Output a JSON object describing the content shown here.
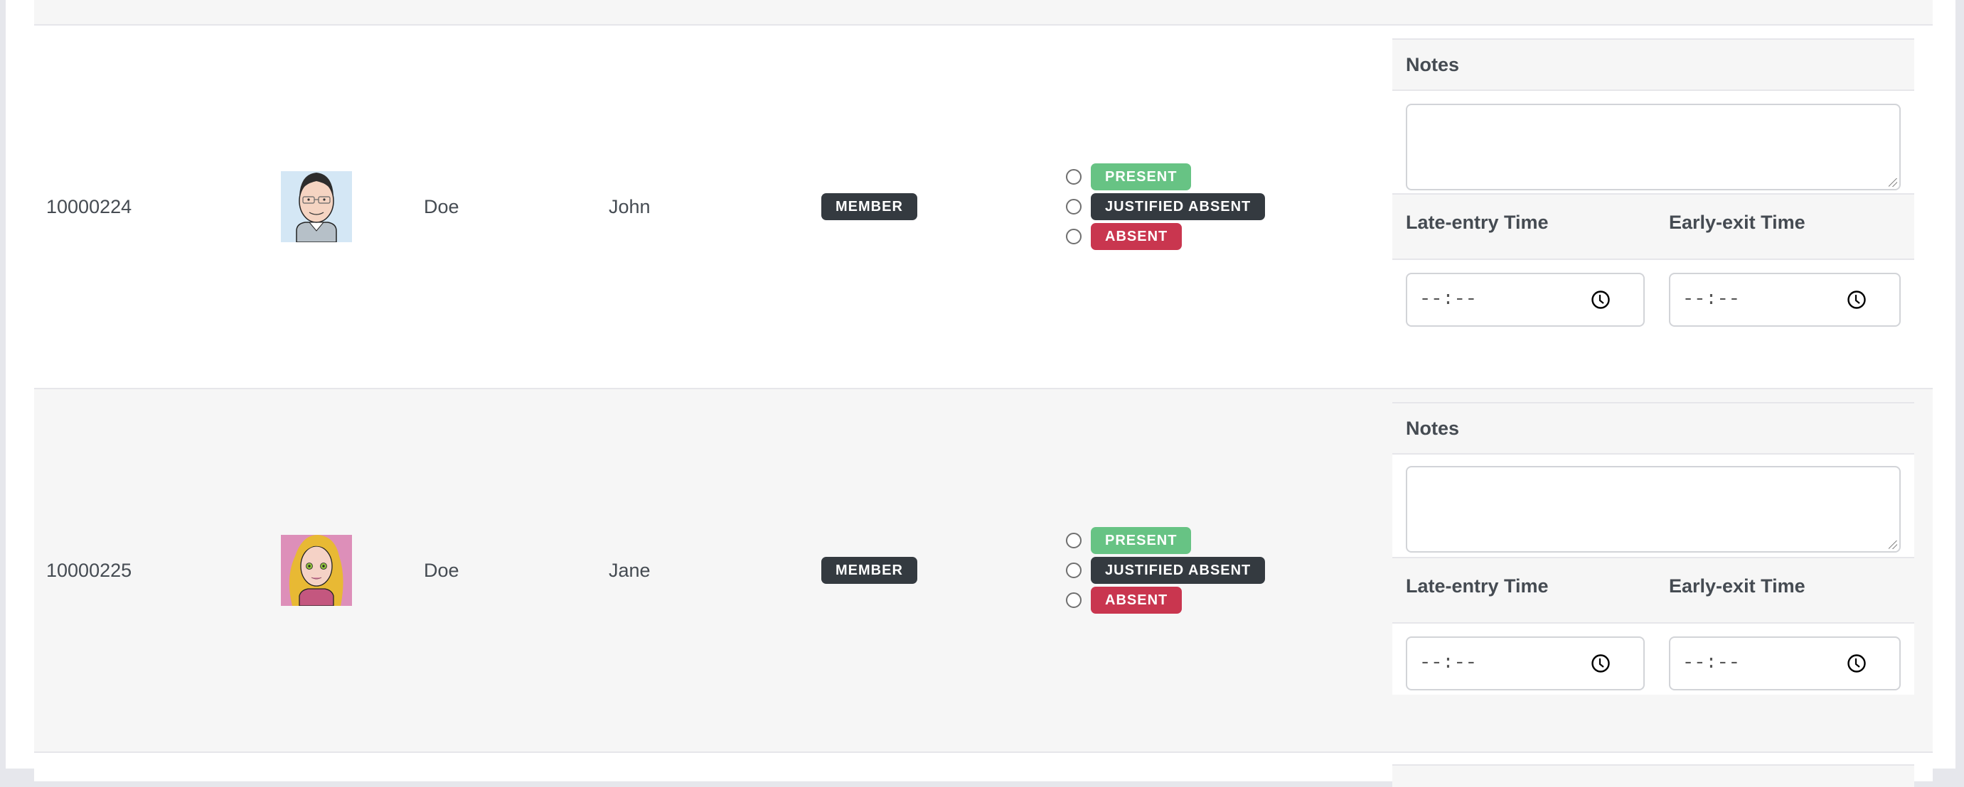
{
  "roster": {
    "rows": [
      {
        "id": "10000224",
        "avatar": "male-cartoon-avatar",
        "avatar_bg": "#d4e7f5",
        "last_name": "Doe",
        "first_name": "John",
        "role": "MEMBER",
        "status_options": [
          {
            "label": "PRESENT",
            "color": "#67c384",
            "selected": false
          },
          {
            "label": "JUSTIFIED ABSENT",
            "color": "#343a40",
            "selected": false
          },
          {
            "label": "ABSENT",
            "color": "#c9364f",
            "selected": false
          }
        ],
        "notes_label": "Notes",
        "notes_value": "",
        "late_entry_label": "Late-entry Time",
        "late_entry_value": "--:--",
        "early_exit_label": "Early-exit Time",
        "early_exit_value": "--:--"
      },
      {
        "id": "10000225",
        "avatar": "female-cartoon-avatar",
        "avatar_bg": "#dd8fb9",
        "last_name": "Doe",
        "first_name": "Jane",
        "role": "MEMBER",
        "status_options": [
          {
            "label": "PRESENT",
            "color": "#67c384",
            "selected": false
          },
          {
            "label": "JUSTIFIED ABSENT",
            "color": "#343a40",
            "selected": false
          },
          {
            "label": "ABSENT",
            "color": "#c9364f",
            "selected": false
          }
        ],
        "notes_label": "Notes",
        "notes_value": "",
        "late_entry_label": "Late-entry Time",
        "late_entry_value": "--:--",
        "early_exit_label": "Early-exit Time",
        "early_exit_value": "--:--"
      }
    ]
  }
}
